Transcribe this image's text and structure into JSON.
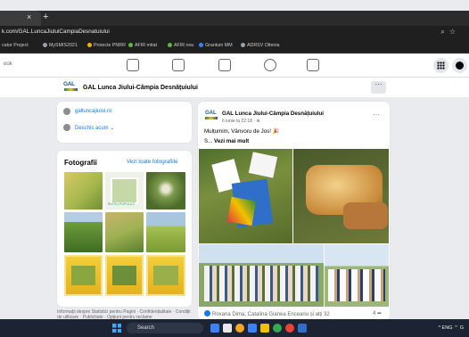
{
  "browser": {
    "tab_close": "×",
    "tab_new": "+",
    "url": "k.com/GAL.LuncaJiuluiCampiaDesnatuiului",
    "bookmarks": [
      "cator Project",
      "MySMIS2021",
      "Proiecte PNRR",
      "AFIR mitat",
      "AFIR nou",
      "Grantuin MM",
      "ADRSV Oltenia"
    ]
  },
  "fbnav": {
    "search_placeholder": "ook"
  },
  "page": {
    "name": "GAL Lunca Jiului-Câmpia Desnățuiului",
    "more": "···"
  },
  "intro": {
    "website": "galluncajiului.ro",
    "hours": "Deschis acum",
    "hours_chevron": "⌄"
  },
  "photos": {
    "title": "Fotografii",
    "see_all": "Vezi toate fotografiile",
    "thumb_caption": "ENTRU POPULATI"
  },
  "footer": "Informații despre Statistici pentru Pagini · Confidențialitate · Condiții de utilizare · Publicitate · Opțiuni pentru reclame",
  "post": {
    "author": "GAL Lunca Jiului-Câmpia Desnățuiului",
    "date": "6 iunie la 22:18 · ⊕",
    "text": "Mulțumim, Vânvoru de Jos! 🎉",
    "see_more_prefix": "S...",
    "see_more": "Vezi mai mult",
    "reactions": "Roxana Dima, Catalina Gianea Enceanu și alți 32",
    "comments": "4 ➦",
    "more": "···"
  },
  "taskbar": {
    "search": "Search",
    "tray": "^  ENG  ⌔  G"
  }
}
